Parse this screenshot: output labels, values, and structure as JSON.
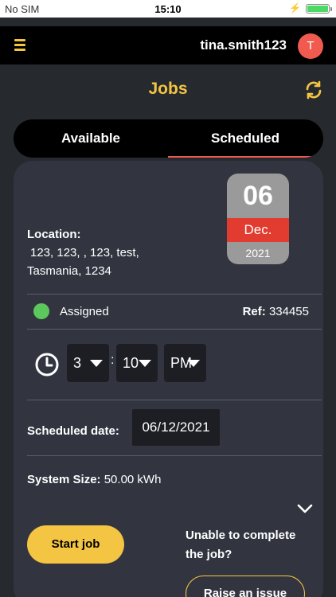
{
  "status_bar": {
    "carrier": "No SIM",
    "time": "15:10"
  },
  "app_bar": {
    "username": "tina.smith123",
    "avatar_initial": "T"
  },
  "header": {
    "title": "Jobs"
  },
  "tabs": [
    {
      "label": "Available",
      "active": false
    },
    {
      "label": "Scheduled",
      "active": true
    }
  ],
  "job": {
    "date": {
      "day": "06",
      "month": "Dec.",
      "year": "2021"
    },
    "location_label": "Location:",
    "location_line1": "123, 123, , 123, test,",
    "location_line2": "Tasmania, 1234",
    "status": "Assigned",
    "ref_label": "Ref:",
    "ref_value": "334455",
    "time": {
      "hour": "3",
      "separator": ":",
      "minute": "10",
      "ampm": "PM"
    },
    "scheduled_date_label": "Scheduled date:",
    "scheduled_date_value": "06/12/2021",
    "system_size_label": "System Size:",
    "system_size_value": "50.00 kWh",
    "start_button": "Start job",
    "unable_text": "Unable to complete the job?",
    "raise_issue_button": "Raise an issue"
  },
  "colors": {
    "accent": "#f4c542",
    "danger": "#f05a4f",
    "status_assigned": "#5cc75c"
  },
  "icons": [
    "menu-icon",
    "refresh-icon",
    "clock-icon",
    "chevron-down-icon"
  ]
}
